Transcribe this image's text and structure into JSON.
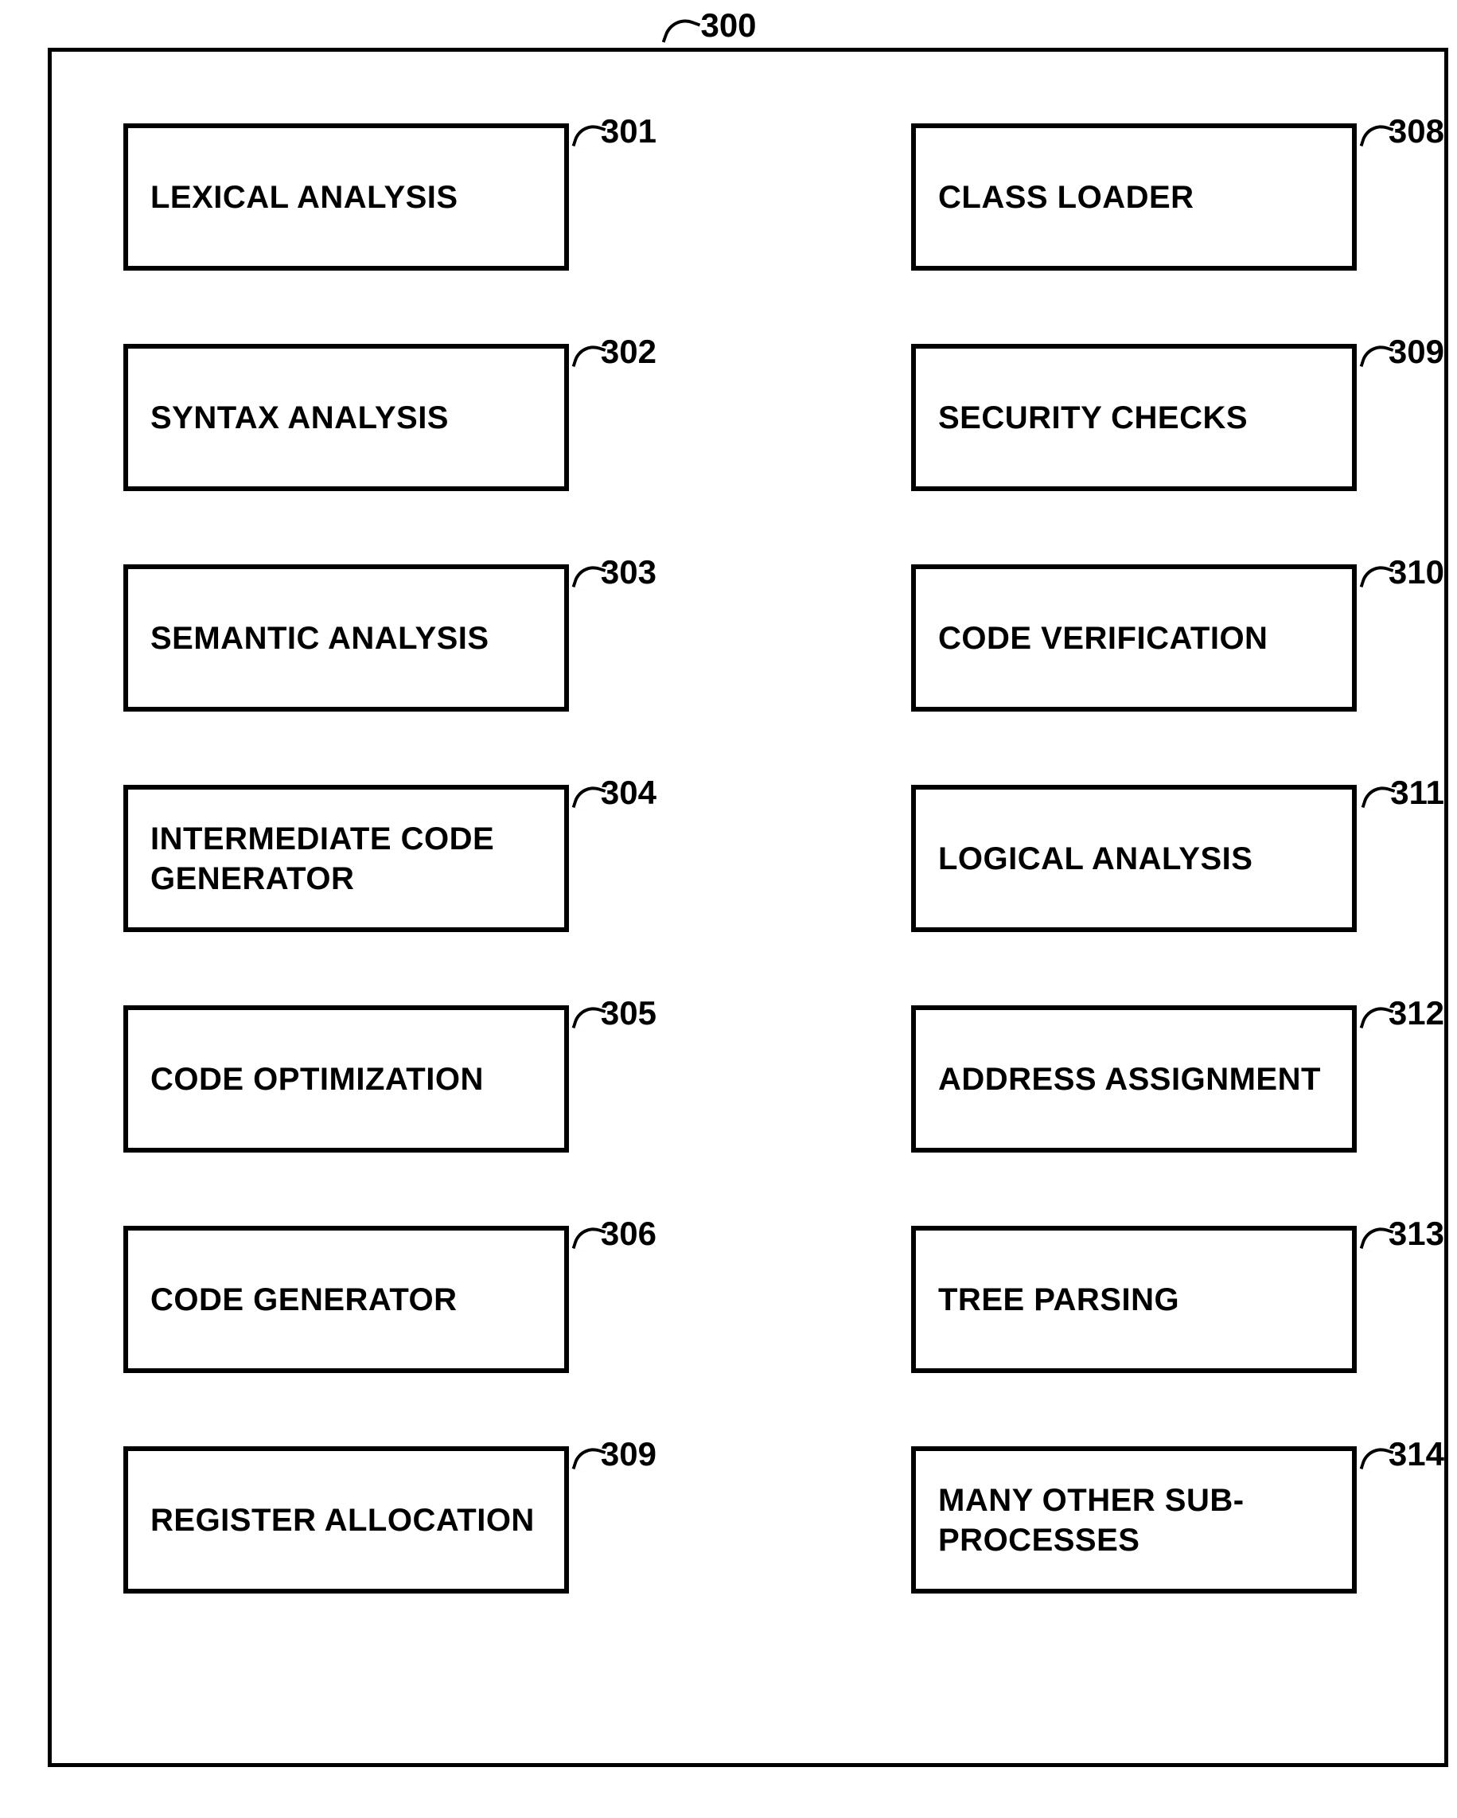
{
  "container_ref": "300",
  "left_column": [
    {
      "label": "LEXICAL ANALYSIS",
      "ref": "301"
    },
    {
      "label": "SYNTAX ANALYSIS",
      "ref": "302"
    },
    {
      "label": "SEMANTIC ANALYSIS",
      "ref": "303"
    },
    {
      "label": "INTERMEDIATE CODE GENERATOR",
      "ref": "304"
    },
    {
      "label": "CODE OPTIMIZATION",
      "ref": "305"
    },
    {
      "label": "CODE GENERATOR",
      "ref": "306"
    },
    {
      "label": "REGISTER ALLOCATION",
      "ref": "309"
    }
  ],
  "right_column": [
    {
      "label": "CLASS LOADER",
      "ref": "308"
    },
    {
      "label": "SECURITY CHECKS",
      "ref": "309"
    },
    {
      "label": "CODE VERIFICATION",
      "ref": "310"
    },
    {
      "label": "LOGICAL ANALYSIS",
      "ref": "311"
    },
    {
      "label": "ADDRESS ASSIGNMENT",
      "ref": "312"
    },
    {
      "label": "TREE PARSING",
      "ref": "313"
    },
    {
      "label": "MANY OTHER SUB-PROCESSES",
      "ref": "314"
    }
  ]
}
